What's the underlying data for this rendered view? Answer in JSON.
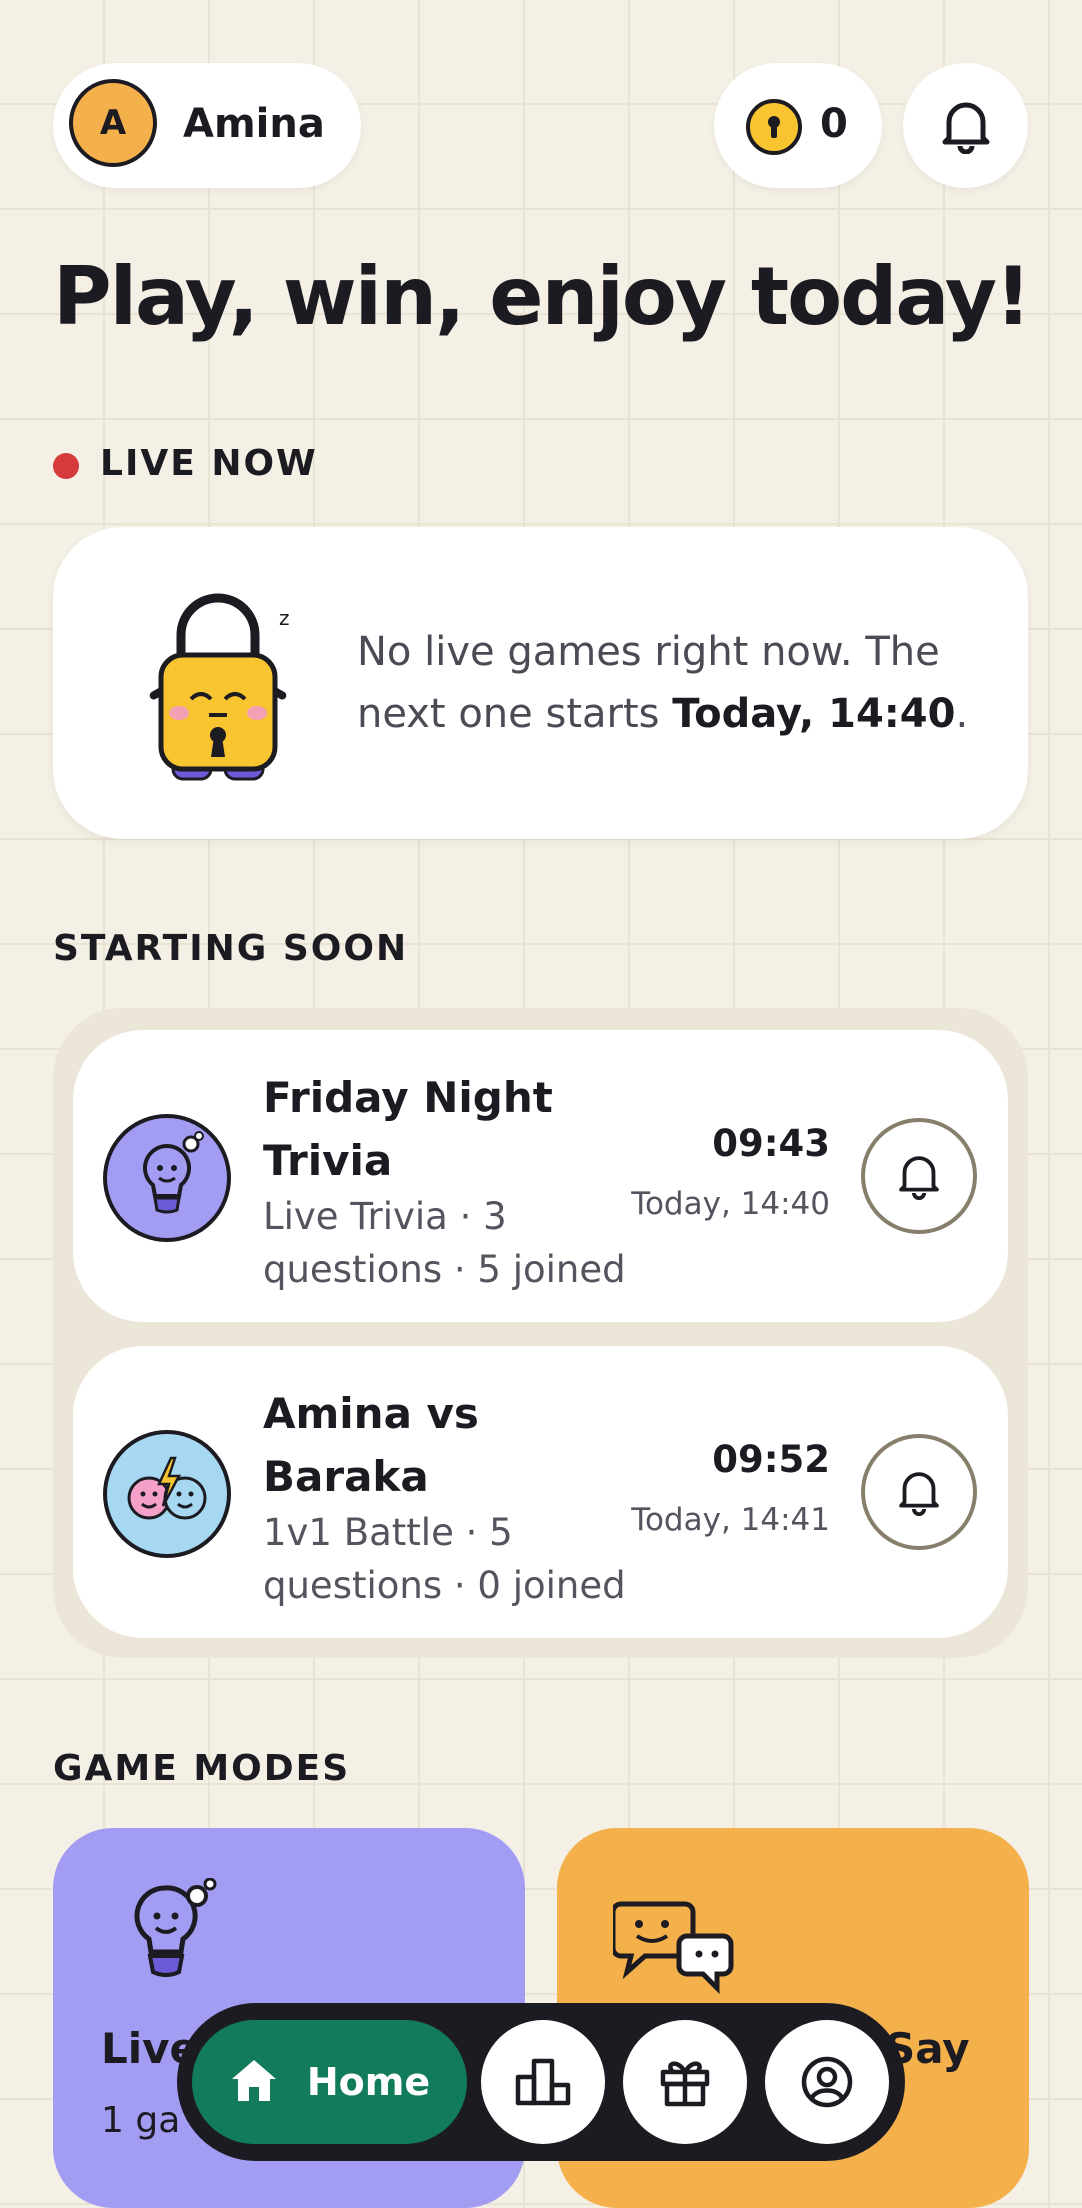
{
  "header": {
    "avatar_initial": "A",
    "user_name": "Amina",
    "coins": "0"
  },
  "headline": "Play, win, enjoy today!",
  "live": {
    "label": "LIVE NOW",
    "message_start": "No live games right now. The next one starts ",
    "message_time": "Today, 14:40",
    "message_end": "."
  },
  "starting_soon": {
    "label": "STARTING SOON",
    "games": [
      {
        "title": "Friday Night Trivia",
        "subtitle": "Live Trivia · 3 questions · 5 joined",
        "countdown": "09:43",
        "start": "Today, 14:40",
        "icon": "lightbulb-icon"
      },
      {
        "title": "Amina vs Baraka",
        "subtitle": "1v1 Battle · 5 questions · 0 joined",
        "countdown": "09:52",
        "start": "Today, 14:41",
        "icon": "versus-faces-icon"
      }
    ]
  },
  "game_modes": {
    "label": "GAME MODES",
    "modes": [
      {
        "title_visible": "Live",
        "sub_visible": "1 ga",
        "color": "#a29cf3"
      },
      {
        "title_visible": "Say",
        "color": "#f4b04b"
      }
    ]
  },
  "nav": {
    "home_label": "Home",
    "items": [
      "home",
      "leaderboard",
      "rewards",
      "profile"
    ]
  },
  "colors": {
    "background": "#f4f0e6",
    "accent_green": "#127b5c",
    "live_red": "#d63a3a",
    "purple": "#a29cf3",
    "orange": "#f4b04b"
  }
}
